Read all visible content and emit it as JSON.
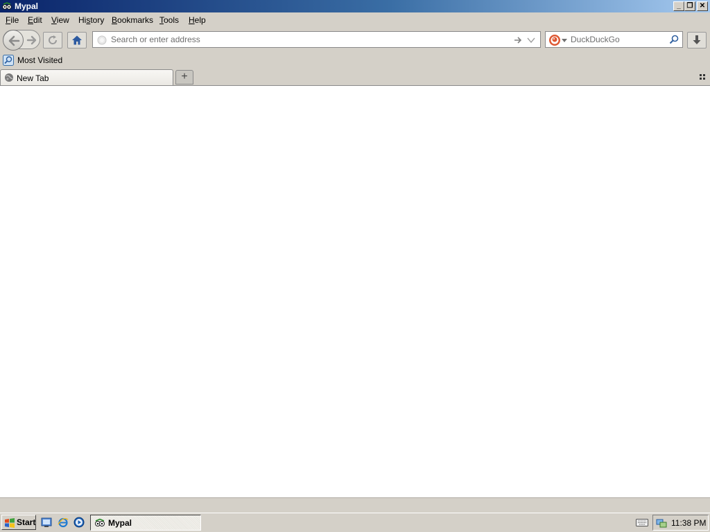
{
  "window": {
    "title": "Mypal",
    "min_glyph": "_",
    "max_glyph": "❐",
    "close_glyph": "✕"
  },
  "menu": {
    "items": [
      {
        "pre": "",
        "key": "F",
        "post": "ile"
      },
      {
        "pre": "",
        "key": "E",
        "post": "dit"
      },
      {
        "pre": "",
        "key": "V",
        "post": "iew"
      },
      {
        "pre": "Hi",
        "key": "s",
        "post": "tory"
      },
      {
        "pre": "",
        "key": "B",
        "post": "ookmarks"
      },
      {
        "pre": "",
        "key": "T",
        "post": "ools"
      },
      {
        "pre": "",
        "key": "H",
        "post": "elp"
      }
    ]
  },
  "urlbar": {
    "placeholder": "Search or enter address",
    "value": ""
  },
  "search": {
    "placeholder": "DuckDuckGo",
    "value": ""
  },
  "bookmarks": {
    "items": [
      {
        "label": "Most Visited"
      }
    ]
  },
  "tabs": [
    {
      "label": "New Tab",
      "selected": true
    }
  ],
  "newtab_glyph": "+",
  "taskbar": {
    "start_label": "Start",
    "window_button": "Mypal",
    "clock": "11:38 PM"
  },
  "colors": {
    "titlebar_start": "#0a246a",
    "titlebar_end": "#a6caf0",
    "chrome": "#d4d0c8",
    "content": "#ffffff",
    "duckduckgo": "#de5833"
  }
}
